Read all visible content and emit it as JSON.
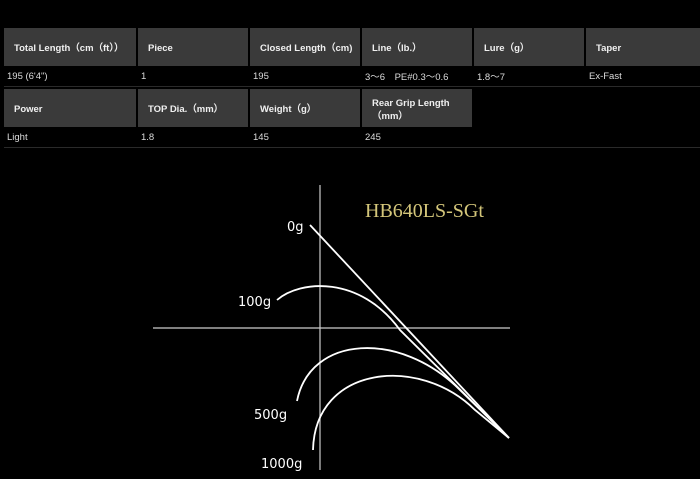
{
  "specs": {
    "headers_row1": [
      "Total Length（cm（ft））",
      "Piece",
      "Closed Length（cm)",
      "Line（lb.）",
      "Lure（g）",
      "Taper"
    ],
    "values_row1": [
      "195 (6'4\")",
      "1",
      "195",
      "3～6　PE#0.3～0.6",
      "1.8～7",
      "Ex-Fast"
    ],
    "headers_row2": [
      "Power",
      "TOP Dia.（mm）",
      "Weight（g）",
      "Rear Grip Length（mm）"
    ],
    "values_row2": [
      "Light",
      "1.8",
      "145",
      "245"
    ]
  },
  "diagram": {
    "model": "HB640LS-SGt",
    "loads": [
      "0g",
      "100g",
      "500g",
      "1000g"
    ],
    "colors": {
      "curves": "#ffffff",
      "axes": "#cccccc",
      "model_text": "#d4c67a"
    }
  }
}
